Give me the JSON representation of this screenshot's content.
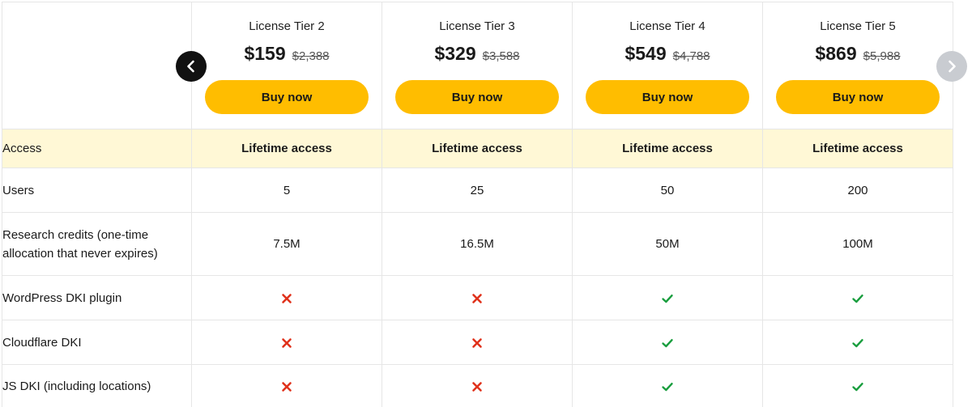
{
  "tiers": [
    {
      "name": "License Tier 2",
      "price": "$159",
      "old_price": "$2,388",
      "button_label": "Buy now"
    },
    {
      "name": "License Tier 3",
      "price": "$329",
      "old_price": "$3,588",
      "button_label": "Buy now"
    },
    {
      "name": "License Tier 4",
      "price": "$549",
      "old_price": "$4,788",
      "button_label": "Buy now"
    },
    {
      "name": "License Tier 5",
      "price": "$869",
      "old_price": "$5,988",
      "button_label": "Buy now"
    }
  ],
  "rows": {
    "access": {
      "label": "Access",
      "values": [
        "Lifetime access",
        "Lifetime access",
        "Lifetime access",
        "Lifetime access"
      ]
    },
    "users": {
      "label": "Users",
      "values": [
        "5",
        "25",
        "50",
        "200"
      ]
    },
    "credits": {
      "label": "Research credits (one-time allocation that never expires)",
      "values": [
        "7.5M",
        "16.5M",
        "50M",
        "100M"
      ]
    },
    "wordpress": {
      "label": "WordPress DKI plugin",
      "included": [
        false,
        false,
        true,
        true
      ]
    },
    "cloudflare": {
      "label": "Cloudflare DKI",
      "included": [
        false,
        false,
        true,
        true
      ]
    },
    "js": {
      "label": "JS DKI (including locations)",
      "included": [
        false,
        false,
        true,
        true
      ]
    }
  },
  "icons": {
    "prev": "chevron-left-icon",
    "next": "chevron-right-icon",
    "included": "check-icon",
    "excluded": "cross-icon"
  },
  "colors": {
    "accent": "#ffbd00",
    "highlight_row": "#fff8d6",
    "check": "#1a9e3f",
    "cross": "#e0321c",
    "prev_button": "#111111",
    "next_button": "#c9ccd1"
  }
}
